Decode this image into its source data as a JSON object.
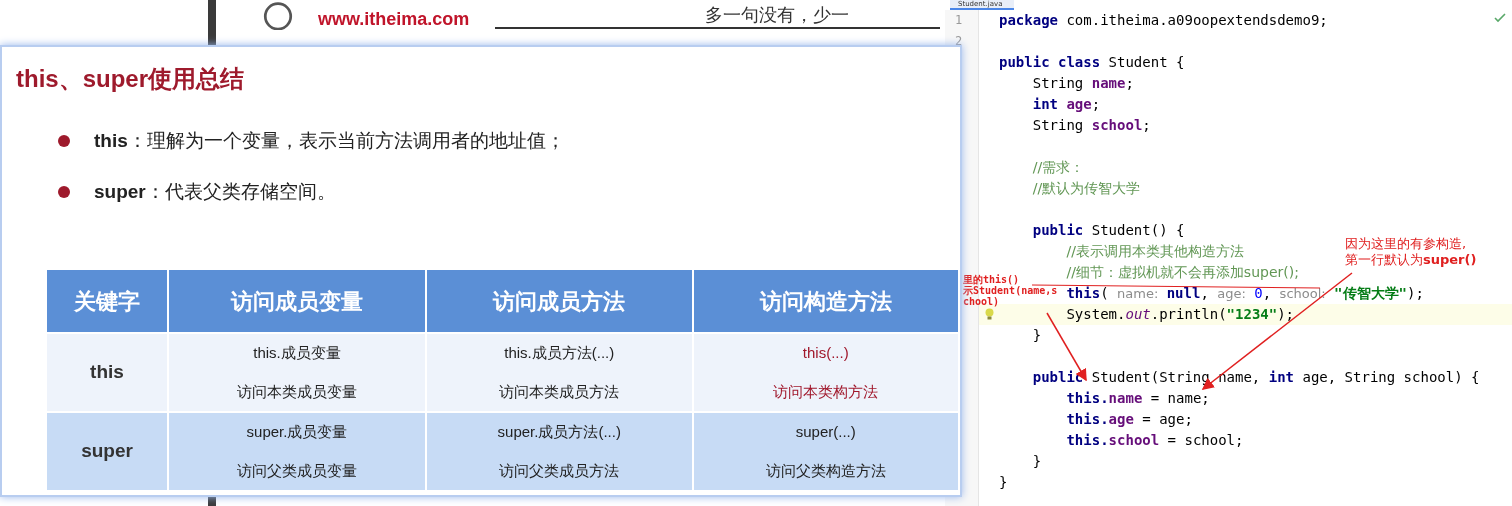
{
  "background_slide": {
    "site": "www.itheima.com",
    "slogan": "多一句没有，少一"
  },
  "slide": {
    "title": "this、super使用总结",
    "bullets": [
      "**this**：理解为一个变量，表示当前方法调用者的地址值；",
      "**super**：代表父类存储空间。"
    ],
    "table": {
      "columns": [
        "关键字",
        "访问成员变量",
        "访问成员方法",
        "访问构造方法"
      ],
      "rows": [
        {
          "cells": [
            {
              "kind": "keyword",
              "lines": [
                "this"
              ],
              "emphasis": false
            },
            {
              "kind": "pair",
              "emphasis": false,
              "lines": [
                "this.成员变量",
                "访问本类成员变量"
              ]
            },
            {
              "kind": "pair",
              "emphasis": false,
              "lines": [
                "this.成员方法(...)",
                "访问本类成员方法"
              ]
            },
            {
              "kind": "pair",
              "emphasis": true,
              "lines": [
                "this(...)",
                "访问本类构方法"
              ]
            }
          ]
        },
        {
          "cells": [
            {
              "kind": "keyword",
              "lines": [
                "super"
              ],
              "emphasis": false
            },
            {
              "kind": "pair",
              "emphasis": false,
              "lines": [
                "super.成员变量",
                "访问父类成员变量"
              ]
            },
            {
              "kind": "pair",
              "emphasis": false,
              "lines": [
                "super.成员方法(...)",
                "访问父类成员方法"
              ]
            },
            {
              "kind": "pair",
              "emphasis": false,
              "lines": [
                "super(...)",
                "访问父类构造方法"
              ]
            }
          ]
        }
      ]
    }
  },
  "editor": {
    "tab": "Student.java",
    "lines": [
      {
        "kind": "code",
        "number": "1",
        "tokens": [
          {
            "text": "package",
            "kind": "kw"
          },
          {
            "text": " com.itheima.a09oopextendsdemo9;",
            "kind": "plain"
          }
        ]
      },
      {
        "kind": "blank",
        "number": "2"
      },
      {
        "kind": "code",
        "tokens": [
          {
            "text": "public class",
            "kind": "kw"
          },
          {
            "text": " Student {",
            "kind": "plain"
          }
        ]
      },
      {
        "kind": "code",
        "tokens": [
          {
            "text": "    String ",
            "kind": "plain"
          },
          {
            "text": "name",
            "kind": "field"
          },
          {
            "text": ";",
            "kind": "plain"
          }
        ]
      },
      {
        "kind": "code",
        "tokens": [
          {
            "text": "    int",
            "kind": "kw"
          },
          {
            "text": " age",
            "kind": "field"
          },
          {
            "text": ";",
            "kind": "plain"
          }
        ]
      },
      {
        "kind": "code",
        "tokens": [
          {
            "text": "    String ",
            "kind": "plain"
          },
          {
            "text": "school",
            "kind": "field"
          },
          {
            "text": ";",
            "kind": "plain"
          }
        ]
      },
      {
        "kind": "blank"
      },
      {
        "kind": "code",
        "tokens": [
          {
            "text": "    //需求：",
            "kind": "comment"
          }
        ]
      },
      {
        "kind": "code",
        "tokens": [
          {
            "text": "    //默认为传智大学",
            "kind": "comment"
          }
        ]
      },
      {
        "kind": "blank"
      },
      {
        "kind": "code",
        "tokens": [
          {
            "text": "    public",
            "kind": "kw"
          },
          {
            "text": " Student() {",
            "kind": "plain"
          }
        ]
      },
      {
        "kind": "code",
        "tokens": [
          {
            "text": "        //表示调用本类其他构造方法",
            "kind": "comment"
          }
        ]
      },
      {
        "kind": "code",
        "tokens": [
          {
            "text": "        //细节：虚拟机就不会再添加super();",
            "kind": "comment"
          }
        ]
      },
      {
        "kind": "code",
        "tokens": [
          {
            "text": "        this",
            "kind": "kw"
          },
          {
            "text": "( ",
            "kind": "plain"
          },
          {
            "text": "name:",
            "kind": "hint"
          },
          {
            "text": " null",
            "kind": "kw"
          },
          {
            "text": ", ",
            "kind": "plain"
          },
          {
            "text": "age:",
            "kind": "hint"
          },
          {
            "text": " 0",
            "kind": "number"
          },
          {
            "text": ", ",
            "kind": "plain"
          },
          {
            "text": "school:",
            "kind": "hint"
          },
          {
            "text": " \"传智大学\"",
            "kind": "string"
          },
          {
            "text": ");",
            "kind": "plain"
          }
        ]
      },
      {
        "kind": "code",
        "current": true,
        "bulb": true,
        "tokens": [
          {
            "text": "        System.",
            "kind": "plain"
          },
          {
            "text": "out",
            "kind": "static"
          },
          {
            "text": ".println(",
            "kind": "plain"
          },
          {
            "text": "\"1234\"",
            "kind": "string"
          },
          {
            "text": ");",
            "kind": "plain"
          }
        ]
      },
      {
        "kind": "code",
        "tokens": [
          {
            "text": "    }",
            "kind": "plain"
          }
        ]
      },
      {
        "kind": "blank"
      },
      {
        "kind": "code",
        "tokens": [
          {
            "text": "    public",
            "kind": "kw"
          },
          {
            "text": " Student(String name, ",
            "kind": "plain"
          },
          {
            "text": "int",
            "kind": "kw"
          },
          {
            "text": " age, String school) {",
            "kind": "plain"
          }
        ]
      },
      {
        "kind": "code",
        "tokens": [
          {
            "text": "        this.",
            "kind": "kw"
          },
          {
            "text": "name",
            "kind": "field"
          },
          {
            "text": " = name;",
            "kind": "plain"
          }
        ]
      },
      {
        "kind": "code",
        "tokens": [
          {
            "text": "        this.",
            "kind": "kw"
          },
          {
            "text": "age",
            "kind": "field"
          },
          {
            "text": " = age;",
            "kind": "plain"
          }
        ]
      },
      {
        "kind": "code",
        "tokens": [
          {
            "text": "        this.",
            "kind": "kw"
          },
          {
            "text": "school",
            "kind": "field"
          },
          {
            "text": " = school;",
            "kind": "plain"
          }
        ]
      },
      {
        "kind": "code",
        "tokens": [
          {
            "text": "    }",
            "kind": "plain"
          }
        ]
      },
      {
        "kind": "code",
        "tokens": [
          {
            "text": "}",
            "kind": "plain"
          }
        ]
      }
    ],
    "annotations": {
      "callout": [
        "因为这里的有参构造,",
        "第一行默认为**super()**"
      ],
      "side_note": [
        "里的this()",
        "示Student(name,school)"
      ]
    }
  }
}
